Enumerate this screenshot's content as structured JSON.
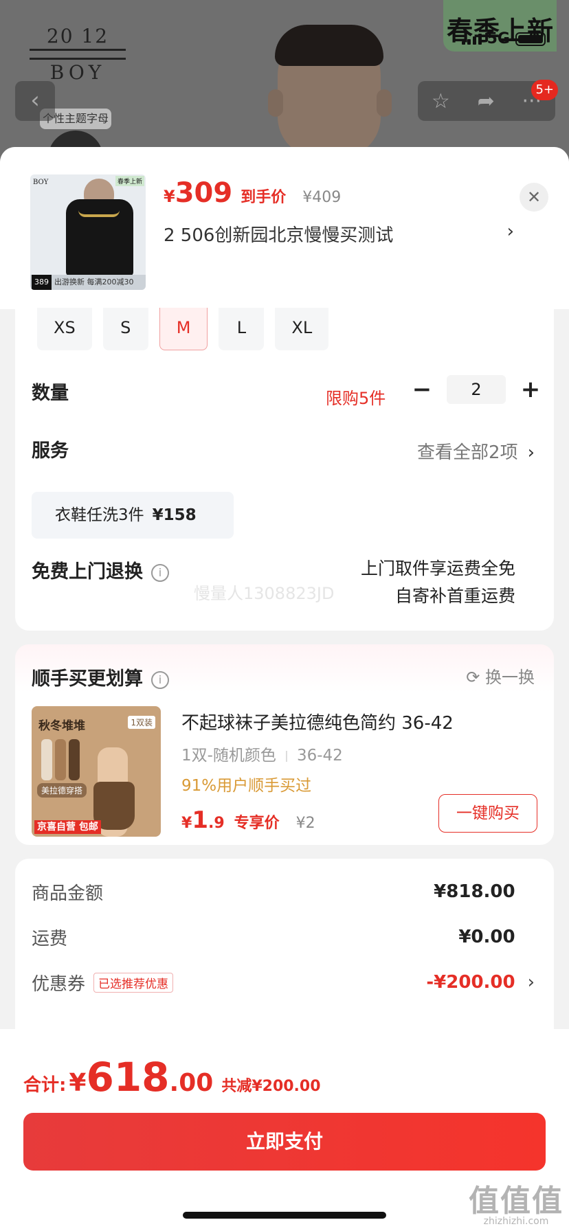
{
  "background": {
    "brand_year": "20 12",
    "brand_name": "BOY",
    "theme_tag": "个性主题字母",
    "promo_text": "春季上新",
    "network": "5G",
    "more_badge": "5+"
  },
  "product": {
    "thumb_brand": "BOY",
    "thumb_tag": "春季上新",
    "thumb_price": "389",
    "thumb_footer": "出游换新 每满200减30",
    "currency": "¥",
    "price": "309",
    "price_label": "到手价",
    "original_price": "¥409",
    "address": "2  506创新园北京慢慢买测试"
  },
  "sizes": [
    "XS",
    "S",
    "M",
    "L",
    "XL"
  ],
  "selected_size": "M",
  "quantity": {
    "label": "数量",
    "limit": "限购5件",
    "value": "2",
    "minus": "−",
    "plus": "+"
  },
  "service": {
    "label": "服务",
    "view_all": "查看全部2项",
    "chip_name": "衣鞋任洗3件",
    "chip_price": "¥158",
    "free_return_label": "免费上门退换",
    "free_return_line1": "上门取件享运费全免",
    "free_return_line2": "自寄补首重运费",
    "watermark": "慢量人1308823JD"
  },
  "addon": {
    "title": "顺手买更划算",
    "swap": "换一换",
    "img_title": "秋冬堆堆",
    "img_pack": "1双装",
    "img_tag": "美拉德穿搭",
    "img_badge": "京喜自营 包邮",
    "name": "不起球袜子美拉德纯色简约 36-42",
    "spec1": "1双-随机颜色",
    "spec2": "36-42",
    "bought": "91%用户顺手买过",
    "currency": "¥",
    "price_int": "1",
    "price_dec": ".9",
    "price_label": "专享价",
    "original": "¥2",
    "buy_label": "一键购买"
  },
  "summary": {
    "goods_label": "商品金额",
    "goods_value": "¥818.00",
    "shipping_label": "运费",
    "shipping_value": "¥0.00",
    "coupon_label": "优惠券",
    "coupon_tag": "已选推荐优惠",
    "coupon_value": "-¥200.00"
  },
  "footer": {
    "total_label": "合计:",
    "currency": "¥",
    "total_int": "618",
    "total_dec": ".00",
    "saved": "共减¥200.00",
    "pay_label": "立即支付",
    "site_big": "值值值",
    "site_small": "zhizhizhi.com"
  },
  "colors": {
    "accent": "#e52e26",
    "gold": "#d99a36"
  }
}
